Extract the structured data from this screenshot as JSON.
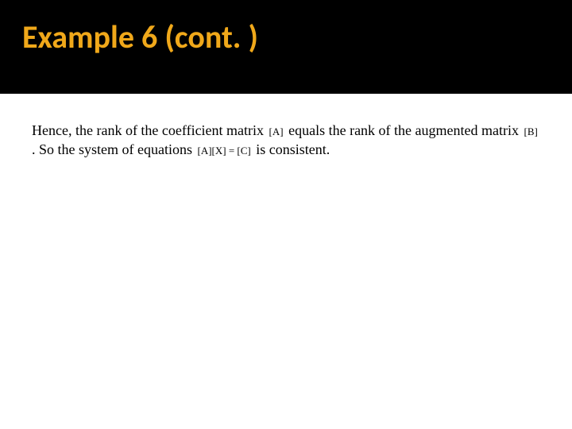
{
  "header": {
    "title": "Example 6 (cont. )"
  },
  "body": {
    "t1": "Hence, the rank of the coefficient matrix ",
    "m1": "[A]",
    "t2": " equals the rank of the augmented matrix ",
    "m2": "[B]",
    "t3": " . So the system of equations ",
    "m3": "[A][X] = [C]",
    "t4": " is consistent."
  }
}
